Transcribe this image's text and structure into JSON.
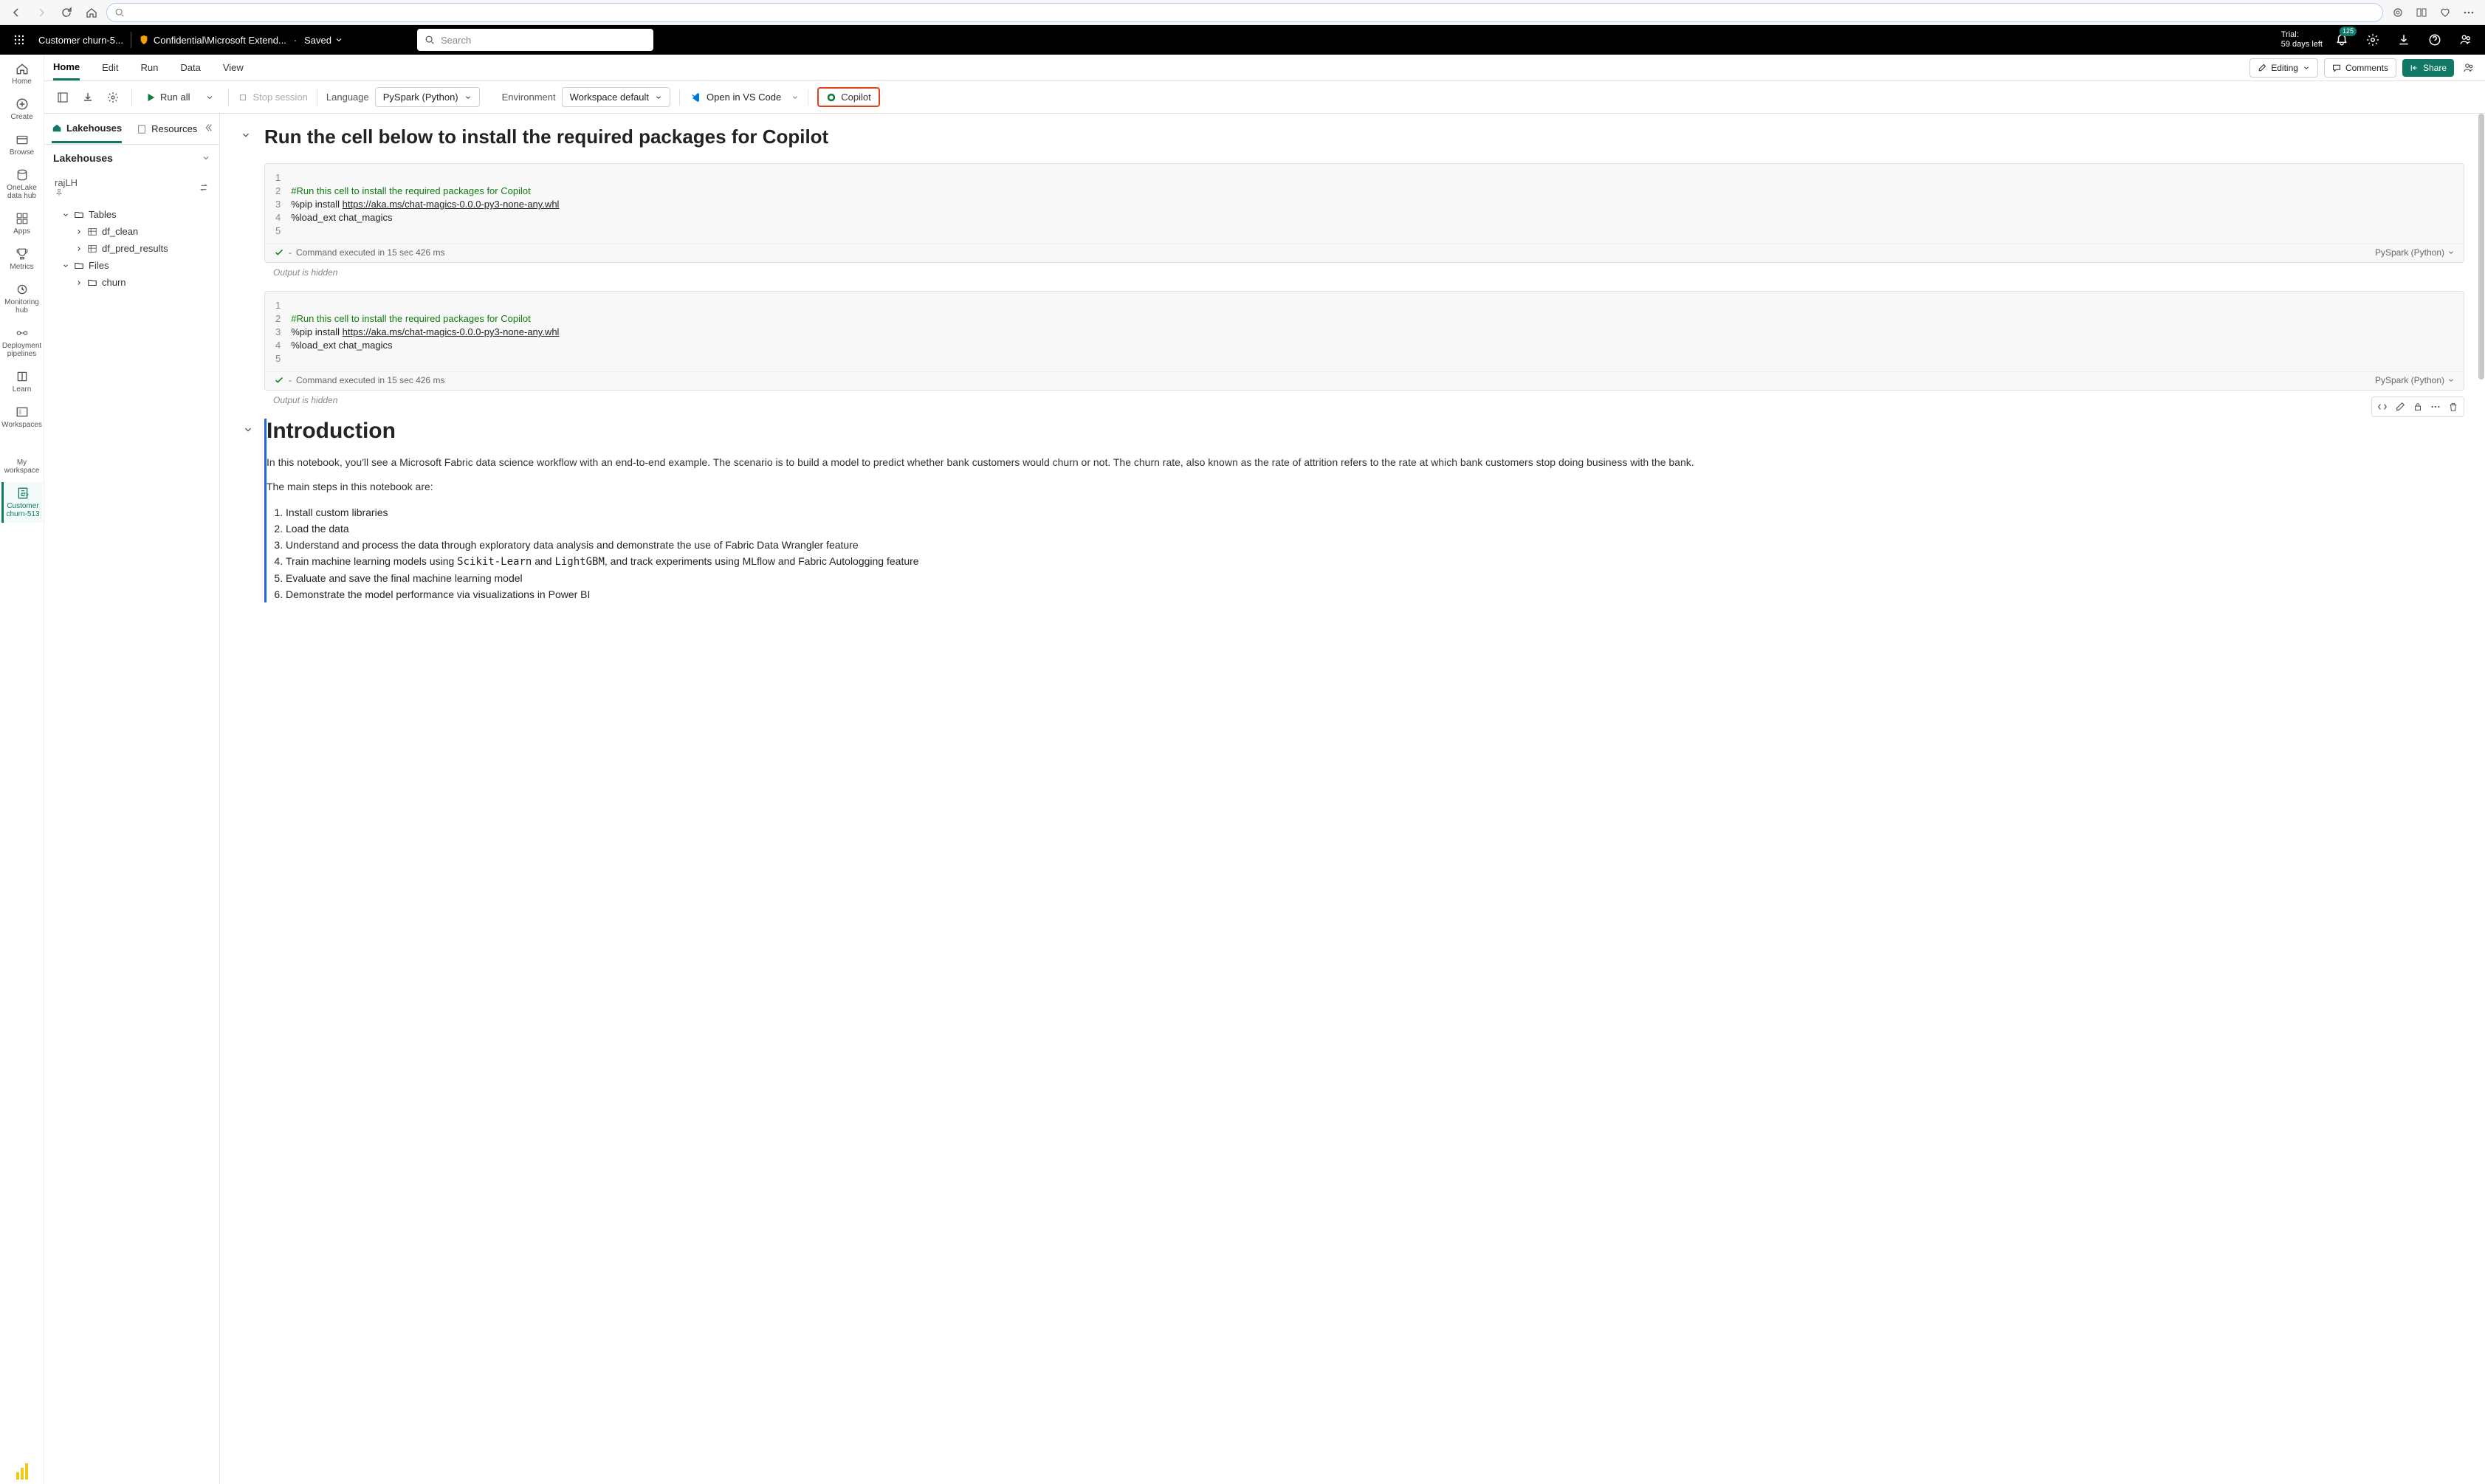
{
  "browser": {
    "search_placeholder": ""
  },
  "topbar": {
    "doc_title": "Customer churn-5...",
    "sensitivity": "Confidential\\Microsoft Extend...",
    "saved_label": "Saved",
    "search_placeholder": "Search",
    "trial_line1": "Trial:",
    "trial_line2": "59 days left",
    "notif_count": "125"
  },
  "ribbon": {
    "tabs": [
      "Home",
      "Edit",
      "Run",
      "Data",
      "View"
    ],
    "editing": "Editing",
    "comments": "Comments",
    "share": "Share"
  },
  "toolbar": {
    "run_all": "Run all",
    "stop_session": "Stop session",
    "language_label": "Language",
    "language_value": "PySpark (Python)",
    "environment_label": "Environment",
    "environment_value": "Workspace default",
    "open_vs": "Open in VS Code",
    "copilot": "Copilot"
  },
  "leftrail": {
    "items": [
      {
        "label": "Home"
      },
      {
        "label": "Create"
      },
      {
        "label": "Browse"
      },
      {
        "label": "OneLake data hub"
      },
      {
        "label": "Apps"
      },
      {
        "label": "Metrics"
      },
      {
        "label": "Monitoring hub"
      },
      {
        "label": "Deployment pipelines"
      },
      {
        "label": "Learn"
      },
      {
        "label": "Workspaces"
      }
    ],
    "my_workspace": "My workspace",
    "active_item": "Customer churn-513"
  },
  "explorer": {
    "tabs": [
      "Lakehouses",
      "Resources"
    ],
    "head": "Lakehouses",
    "db_name": "rajLH",
    "tables_label": "Tables",
    "t1": "df_clean",
    "t2": "df_pred_results",
    "files_label": "Files",
    "f1": "churn"
  },
  "notebook": {
    "h1": "Run the cell below to install the required packages for Copilot",
    "code_lines": {
      "l1": "",
      "l2": "#Run this cell to install the required packages for Copilot",
      "l3a": "%pip install ",
      "l3b": "https://aka.ms/chat-magics-0.0.0-py3-none-any.whl",
      "l4": "%load_ext chat_magics",
      "l5": ""
    },
    "status_prefix": "-",
    "status_text": "Command executed in 15 sec 426 ms",
    "lang_badge": "PySpark (Python)",
    "output_hidden": "Output is hidden",
    "intro_h": "Introduction",
    "intro_p1": "In this notebook, you'll see a Microsoft Fabric data science workflow with an end-to-end example. The scenario is to build a model to predict whether bank customers would churn or not. The churn rate, also known as the rate of attrition refers to the rate at which bank customers stop doing business with the bank.",
    "intro_p2": "The main steps in this notebook are:",
    "steps": [
      "Install custom libraries",
      "Load the data",
      "Understand and process the data through exploratory data analysis and demonstrate the use of Fabric Data Wrangler feature",
      "Train machine learning models using Scikit-Learn and LightGBM, and track experiments using MLflow and Fabric Autologging feature",
      "Evaluate and save the final machine learning model",
      "Demonstrate the model performance via visualizations in Power BI"
    ]
  }
}
